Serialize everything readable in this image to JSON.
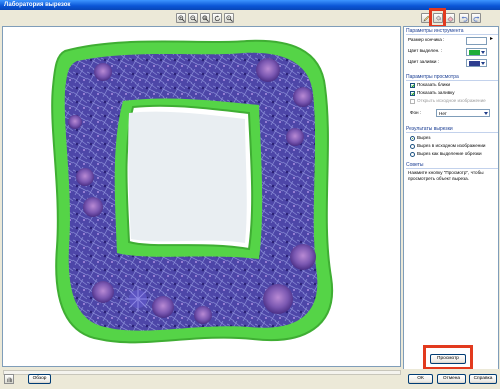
{
  "window": {
    "title": "Лаборатория вырезок"
  },
  "toolbar": {
    "zoom_icons": [
      "zoom-in-icon",
      "zoom-out-icon",
      "zoom-fit-icon",
      "rotate-icon",
      "zoom-100-icon"
    ],
    "tool_icons": [
      "marker-icon",
      "fill-bucket-icon",
      "eraser-icon",
      "undo-icon",
      "redo-icon"
    ],
    "highlight_color": "#e23a1e"
  },
  "panel": {
    "tool_params": {
      "title": "Параметры инструмента",
      "brush_size_label": "Размер кончика :",
      "brush_size_value": "",
      "outline_color_label": "Цвет выделен. :",
      "outline_color": "#1fae3a",
      "fill_color_label": "Цвет заливки :",
      "fill_color": "#2d3d8f"
    },
    "preview_params": {
      "title": "Параметры просмотра",
      "show_outline": "Показать блики",
      "show_fill": "Показать заливку",
      "show_original": "Открыть исходное изображение",
      "bg_label": "Фон :",
      "bg_value": "Нет"
    },
    "result": {
      "title": "Результаты вырезки",
      "opt1": "Вырез",
      "opt2": "Вырез в исходном изображении",
      "opt3": "Вырез как выделение обрезки"
    },
    "tips": {
      "title": "Советы",
      "text": "Нажмите кнопку \"Просмотр\", чтобы просмотреть объект выреза."
    },
    "preview_button": "Просмотр"
  },
  "footer": {
    "browse_button": "Обзор",
    "ok_button": "ОК",
    "cancel_button": "Отмена",
    "help_button": "Справка"
  }
}
